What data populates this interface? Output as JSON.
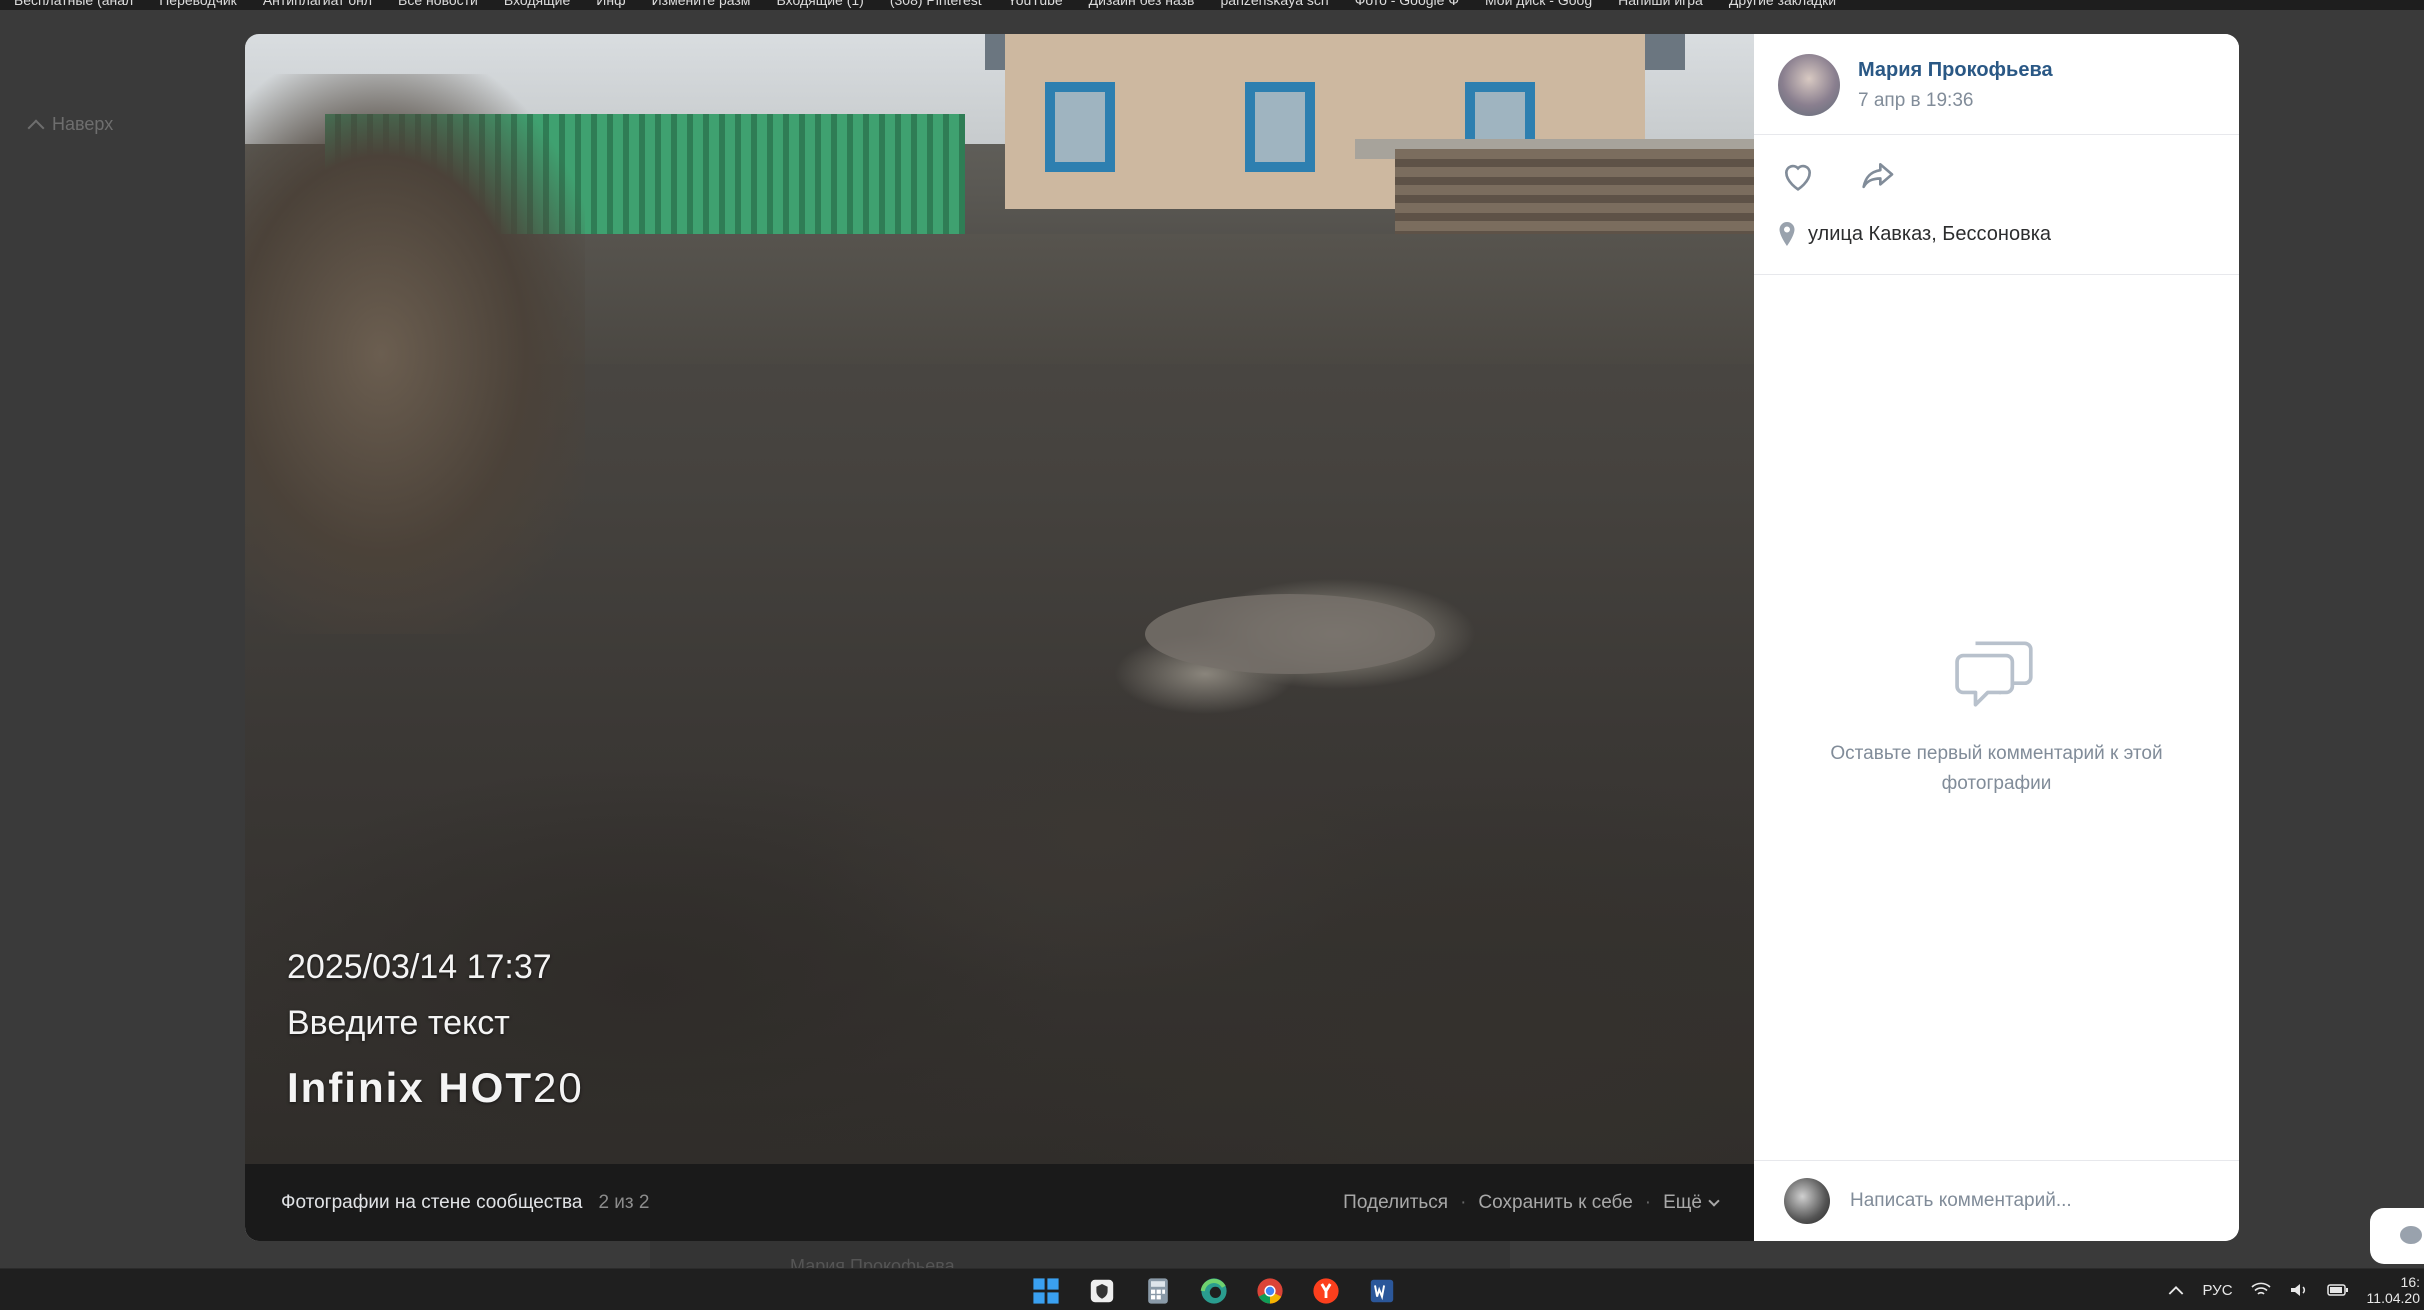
{
  "bookmarks": [
    "Бесплатные (анал",
    "Переводчик",
    "Антиплагиат онл",
    "Все новости",
    "Входящие",
    "Инф",
    "Измените разм",
    "Входящие (1)",
    "(308) Pinterest",
    "YouTube",
    "Дизайн без назв",
    "panzenskaya sch",
    "Фото - Google Ф",
    "Мой диск - Goog",
    "Напиши игра",
    "Другие закладки"
  ],
  "background": {
    "back_link": "Наверх",
    "post_author_partial": "Мария Прокофьева"
  },
  "photo": {
    "watermark_date": "2025/03/14 17:37",
    "watermark_text": "Введите текст",
    "watermark_brand": "Infinix",
    "watermark_model": "HOT",
    "watermark_model_num": "20"
  },
  "footer": {
    "album_title": "Фотографии на стене сообщества",
    "count": "2 из 2",
    "share": "Поделиться",
    "save": "Сохранить к себе",
    "more": "Ещё"
  },
  "panel": {
    "author_name": "Мария Прокофьева",
    "date": "7 апр в 19:36",
    "location": "улица Кавказ, Бессоновка",
    "empty_comments": "Оставьте первый комментарий к этой фотографии",
    "comment_placeholder": "Написать комментарий..."
  },
  "taskbar": {
    "language": "РУС",
    "time": "16:",
    "date": "11.04.20"
  },
  "colors": {
    "link": "#2a5885",
    "secondary_text": "#818c99",
    "viewer_bg": "#1a1a1a"
  }
}
